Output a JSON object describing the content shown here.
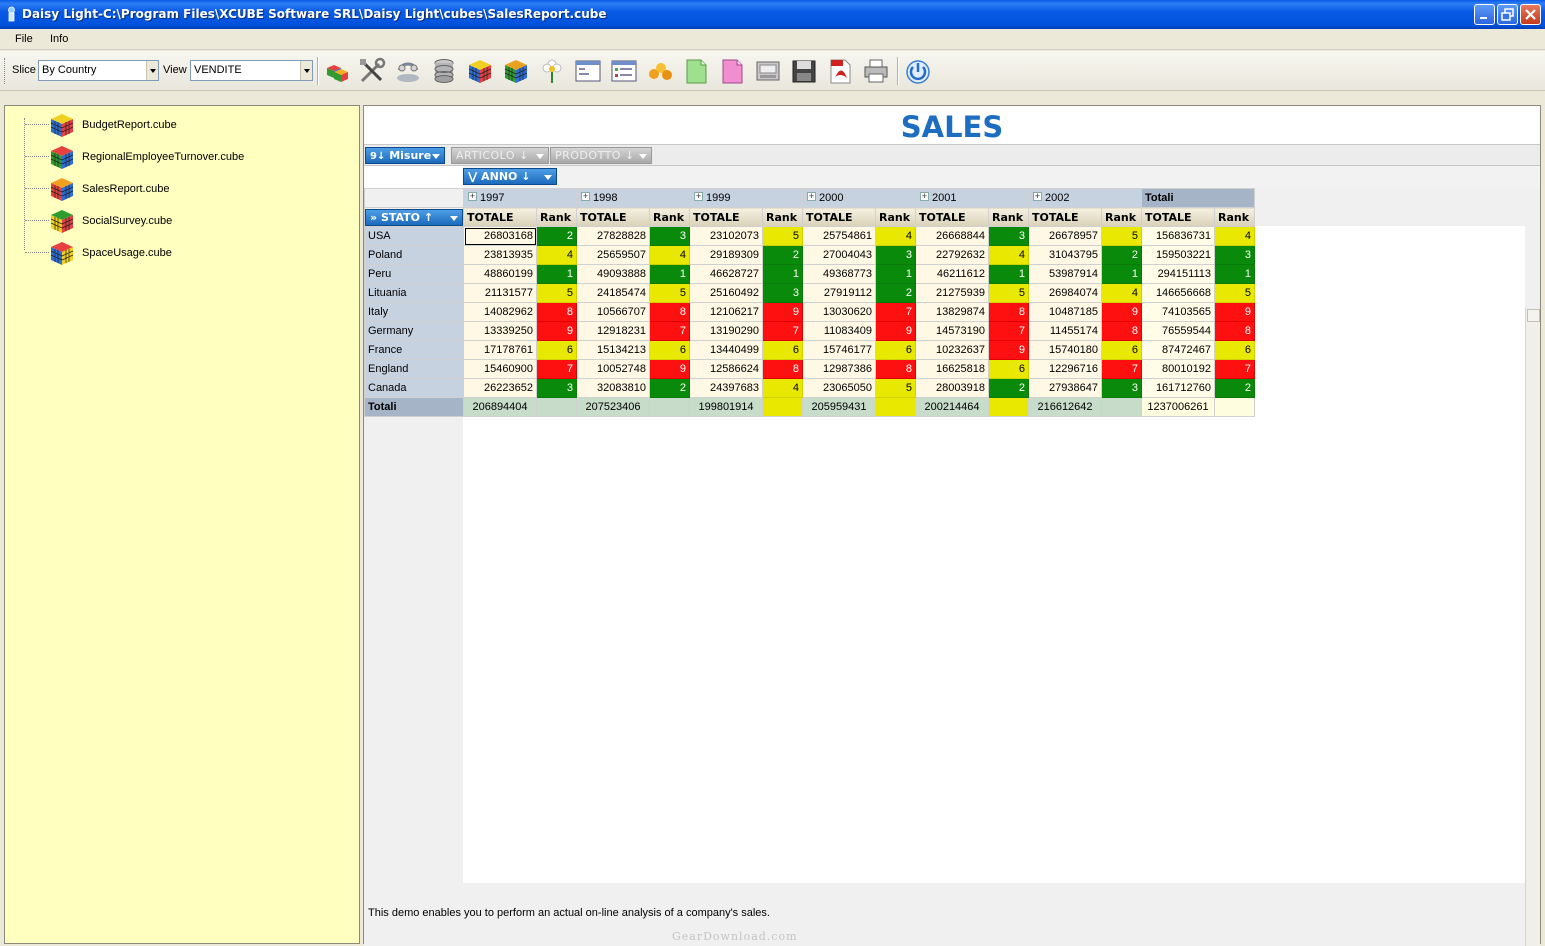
{
  "window": {
    "title": "Daisy Light-C:\\Program Files\\XCUBE Software SRL\\Daisy Light\\cubes\\SalesReport.cube"
  },
  "menu": [
    "File",
    "Info"
  ],
  "toolbar": {
    "slice_label": "Slice",
    "slice_value": "By Country",
    "view_label": "View",
    "view_value": "VENDITE",
    "icons": [
      "cube-add-icon",
      "tools-icon",
      "connect-icon",
      "database-icon",
      "cube-icon",
      "cube-color-icon",
      "flower-icon",
      "window-icon",
      "list-window-icon",
      "chart-icon",
      "export-green-icon",
      "export-pink-icon",
      "scanner-icon",
      "save-icon",
      "pdf-icon",
      "print-icon",
      "power-icon"
    ]
  },
  "tree": {
    "items": [
      "BudgetReport.cube",
      "RegionalEmployeeTurnover.cube",
      "SalesReport.cube",
      "SocialSurvey.cube",
      "SpaceUsage.cube"
    ]
  },
  "report": {
    "title": "SALES",
    "misure_label": "Misure",
    "articolo_label": "ARTICOLO",
    "prodotto_label": "PRODOTTO",
    "anno_label": "ANNO",
    "stato_label": "STATO",
    "years": [
      "1997",
      "1998",
      "1999",
      "2000",
      "2001",
      "2002"
    ],
    "totali_label": "Totali",
    "measure_header": "TOTALE",
    "rank_header": "Rank",
    "rows": [
      {
        "country": "USA",
        "values": [
          [
            "26803168",
            "2",
            "g"
          ],
          [
            "27828828",
            "3",
            "g"
          ],
          [
            "23102073",
            "5",
            "y"
          ],
          [
            "25754861",
            "4",
            "y"
          ],
          [
            "26668844",
            "3",
            "g"
          ],
          [
            "26678957",
            "5",
            "y"
          ],
          [
            "156836731",
            "4",
            "y"
          ]
        ]
      },
      {
        "country": "Poland",
        "values": [
          [
            "23813935",
            "4",
            "y"
          ],
          [
            "25659507",
            "4",
            "y"
          ],
          [
            "29189309",
            "2",
            "g"
          ],
          [
            "27004043",
            "3",
            "g"
          ],
          [
            "22792632",
            "4",
            "y"
          ],
          [
            "31043795",
            "2",
            "g"
          ],
          [
            "159503221",
            "3",
            "g"
          ]
        ]
      },
      {
        "country": "Peru",
        "values": [
          [
            "48860199",
            "1",
            "g"
          ],
          [
            "49093888",
            "1",
            "g"
          ],
          [
            "46628727",
            "1",
            "g"
          ],
          [
            "49368773",
            "1",
            "g"
          ],
          [
            "46211612",
            "1",
            "g"
          ],
          [
            "53987914",
            "1",
            "g"
          ],
          [
            "294151113",
            "1",
            "g"
          ]
        ]
      },
      {
        "country": "Lituania",
        "values": [
          [
            "21131577",
            "5",
            "y"
          ],
          [
            "24185474",
            "5",
            "y"
          ],
          [
            "25160492",
            "3",
            "g"
          ],
          [
            "27919112",
            "2",
            "g"
          ],
          [
            "21275939",
            "5",
            "y"
          ],
          [
            "26984074",
            "4",
            "y"
          ],
          [
            "146656668",
            "5",
            "y"
          ]
        ]
      },
      {
        "country": "Italy",
        "values": [
          [
            "14082962",
            "8",
            "r"
          ],
          [
            "10566707",
            "8",
            "r"
          ],
          [
            "12106217",
            "9",
            "r"
          ],
          [
            "13030620",
            "7",
            "r"
          ],
          [
            "13829874",
            "8",
            "r"
          ],
          [
            "10487185",
            "9",
            "r"
          ],
          [
            "74103565",
            "9",
            "r"
          ]
        ]
      },
      {
        "country": "Germany",
        "values": [
          [
            "13339250",
            "9",
            "r"
          ],
          [
            "12918231",
            "7",
            "r"
          ],
          [
            "13190290",
            "7",
            "r"
          ],
          [
            "11083409",
            "9",
            "r"
          ],
          [
            "14573190",
            "7",
            "r"
          ],
          [
            "11455174",
            "8",
            "r"
          ],
          [
            "76559544",
            "8",
            "r"
          ]
        ]
      },
      {
        "country": "France",
        "values": [
          [
            "17178761",
            "6",
            "y"
          ],
          [
            "15134213",
            "6",
            "y"
          ],
          [
            "13440499",
            "6",
            "y"
          ],
          [
            "15746177",
            "6",
            "y"
          ],
          [
            "10232637",
            "9",
            "r"
          ],
          [
            "15740180",
            "6",
            "y"
          ],
          [
            "87472467",
            "6",
            "y"
          ]
        ]
      },
      {
        "country": "England",
        "values": [
          [
            "15460900",
            "7",
            "r"
          ],
          [
            "10052748",
            "9",
            "r"
          ],
          [
            "12586624",
            "8",
            "r"
          ],
          [
            "12987386",
            "8",
            "r"
          ],
          [
            "16625818",
            "6",
            "y"
          ],
          [
            "12296716",
            "7",
            "r"
          ],
          [
            "80010192",
            "7",
            "r"
          ]
        ]
      },
      {
        "country": "Canada",
        "values": [
          [
            "26223652",
            "3",
            "g"
          ],
          [
            "32083810",
            "2",
            "g"
          ],
          [
            "24397683",
            "4",
            "y"
          ],
          [
            "23065050",
            "5",
            "y"
          ],
          [
            "28003918",
            "2",
            "g"
          ],
          [
            "27938647",
            "3",
            "g"
          ],
          [
            "161712760",
            "2",
            "g"
          ]
        ]
      }
    ],
    "totals_row": {
      "label": "Totali",
      "values": [
        "206894404",
        "207523406",
        "199801914",
        "205959431",
        "200214464",
        "216612642",
        "1237006261"
      ],
      "rank_colors": [
        "n",
        "n",
        "y",
        "y",
        "y",
        "n",
        "w"
      ]
    }
  },
  "status": {
    "description": "This demo enables you to perform an actual on-line analysis of a company's sales."
  },
  "watermark": "GearDownload.com",
  "colors": {
    "rank_green": "#0a8a0a",
    "rank_yellow": "#e8e800",
    "rank_red": "#ff1010",
    "title_blue": "#1d6ec0",
    "tree_bg": "#ffffc0"
  }
}
